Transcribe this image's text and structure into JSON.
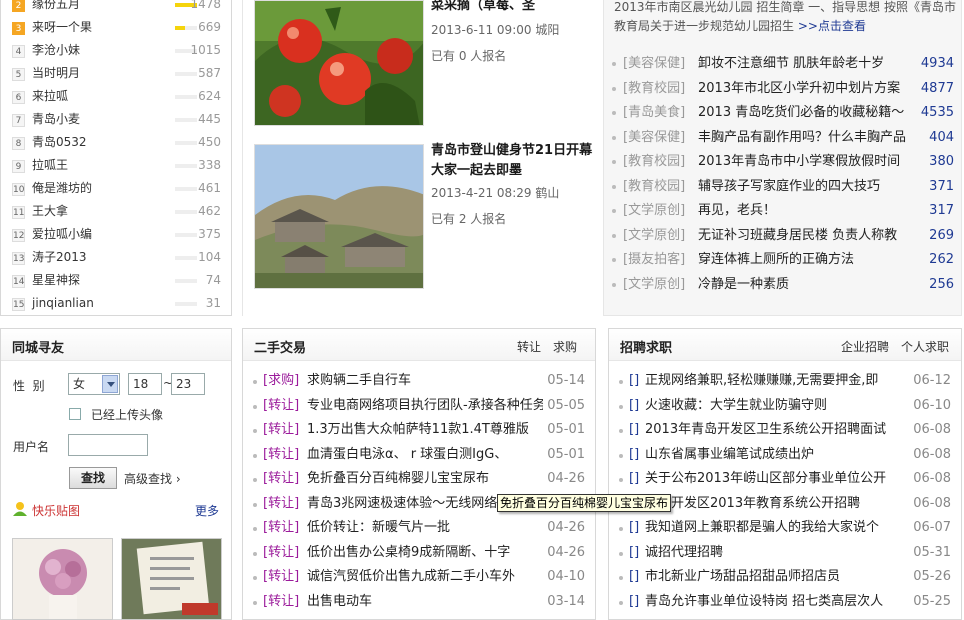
{
  "ranking": {
    "items": [
      {
        "rank": "2",
        "name": "缘份五月",
        "value": "1478",
        "bar": 1.0
      },
      {
        "rank": "3",
        "name": "来呀一个果",
        "value": "669",
        "bar": 0.45
      },
      {
        "rank": "4",
        "name": "李沧小妹",
        "value": "1015",
        "bar": 0.0
      },
      {
        "rank": "5",
        "name": "当时明月",
        "value": "587",
        "bar": 0.0
      },
      {
        "rank": "6",
        "name": "来拉呱",
        "value": "624",
        "bar": 0.0
      },
      {
        "rank": "7",
        "name": "青岛小麦",
        "value": "445",
        "bar": 0.0
      },
      {
        "rank": "8",
        "name": "青岛0532",
        "value": "450",
        "bar": 0.0
      },
      {
        "rank": "9",
        "name": "拉呱王",
        "value": "338",
        "bar": 0.0
      },
      {
        "rank": "10",
        "name": "俺是潍坊的",
        "value": "461",
        "bar": 0.0
      },
      {
        "rank": "11",
        "name": "王大拿",
        "value": "462",
        "bar": 0.0
      },
      {
        "rank": "12",
        "name": "爱拉呱小编",
        "value": "375",
        "bar": 0.0
      },
      {
        "rank": "13",
        "name": "涛子2013",
        "value": "104",
        "bar": 0.0
      },
      {
        "rank": "14",
        "name": "星星神探",
        "value": "74",
        "bar": 0.0
      },
      {
        "rank": "15",
        "name": "jinqianlian",
        "value": "31",
        "bar": 0.0
      }
    ]
  },
  "activities": [
    {
      "title": "菜采摘（草莓、圣",
      "date": "2013-6-11 09:00 城阳",
      "signup": "已有 0 人报名"
    },
    {
      "title": "青岛市登山健身节21日开幕 大家一起去即墨",
      "date": "2013-4-21 08:29 鹤山",
      "signup": "已有 2 人报名"
    }
  ],
  "news": {
    "intro": "2013年市南区晨光幼儿园 招生简章 一、指导思想 按照《青岛市教育局关于进一步规范幼儿园招生",
    "intro_more": ">>点击查看",
    "items": [
      {
        "cat": "[美容保健]",
        "title": "卸妆不注意细节 肌肤年龄老十岁",
        "count": "4934"
      },
      {
        "cat": "[教育校园]",
        "title": "2013年市北区小学升初中划片方案",
        "count": "4877"
      },
      {
        "cat": "[青岛美食]",
        "title": "2013 青岛吃货们必备的收藏秘籍～",
        "count": "4535"
      },
      {
        "cat": "[美容保健]",
        "title": "丰胸产品有副作用吗？什么丰胸产品",
        "count": "404"
      },
      {
        "cat": "[教育校园]",
        "title": "2013年青岛市中小学寒假放假时间",
        "count": "380"
      },
      {
        "cat": "[教育校园]",
        "title": "辅导孩子写家庭作业的四大技巧",
        "count": "371"
      },
      {
        "cat": "[文学原创]",
        "title": "再见，老兵！",
        "count": "317"
      },
      {
        "cat": "[文学原创]",
        "title": "无证补习班藏身居民楼 负责人称教",
        "count": "269"
      },
      {
        "cat": "[摄友拍客]",
        "title": "穿连体裤上厕所的正确方法",
        "count": "262"
      },
      {
        "cat": "[文学原创]",
        "title": "冷静是一种素质",
        "count": "256"
      }
    ]
  },
  "friend": {
    "title": "同城寻友",
    "gender_label": "性  别",
    "gender_value": "女",
    "age_from": "18",
    "age_sep": "~",
    "age_to": "23",
    "avatar_check_label": "已经上传头像",
    "username_label": "用户名",
    "username_value": "",
    "search_button": "查找",
    "advanced_search": "高级查找 ›",
    "stickers_title": "快乐贴图",
    "stickers_more": "更多"
  },
  "trade": {
    "title": "二手交易",
    "link_transfer": "转让",
    "link_buy": "求购",
    "items": [
      {
        "tag": "[求购]",
        "title": "求购辆二手自行车",
        "date": "05-14"
      },
      {
        "tag": "[转让]",
        "title": "专业电商网络项目执行团队-承接各种任务",
        "date": "05-05"
      },
      {
        "tag": "[转让]",
        "title": "1.3万出售大众帕萨特11款1.4T尊雅版",
        "date": "05-01"
      },
      {
        "tag": "[转让]",
        "title": "血清蛋白电泳α、 r 球蛋白测IgG、",
        "date": "05-01"
      },
      {
        "tag": "[转让]",
        "title": "免折叠百分百纯棉婴儿宝宝尿布",
        "date": "04-26"
      },
      {
        "tag": "[转让]",
        "title": "青岛3兆网速极速体验～无线网络",
        "date": "04-26"
      },
      {
        "tag": "[转让]",
        "title": "低价转让：新暖气片一批",
        "date": "04-26"
      },
      {
        "tag": "[转让]",
        "title": "低价出售办公桌椅9成新隔断、十字",
        "date": "04-26"
      },
      {
        "tag": "[转让]",
        "title": "诚信汽贸低价出售九成新二手小车外",
        "date": "04-10"
      },
      {
        "tag": "[转让]",
        "title": "出售电动车",
        "date": "03-14"
      }
    ],
    "tooltip": "免折叠百分百纯棉婴儿宝宝尿布"
  },
  "jobs": {
    "title": "招聘求职",
    "link_company": "企业招聘",
    "link_personal": "个人求职",
    "items": [
      {
        "tag": "[]",
        "title": "正规网络兼职,轻松赚赚赚,无需要押金,即",
        "date": "06-12"
      },
      {
        "tag": "[]",
        "title": "火速收藏：大学生就业防骗守则",
        "date": "06-10"
      },
      {
        "tag": "[]",
        "title": "2013年青岛开发区卫生系统公开招聘面试",
        "date": "06-08"
      },
      {
        "tag": "[]",
        "title": "山东省属事业编笔试成绩出炉",
        "date": "06-08"
      },
      {
        "tag": "[]",
        "title": "关于公布2013年崂山区部分事业单位公开",
        "date": "06-08"
      },
      {
        "tag": "[]",
        "title": "青岛开发区2013年教育系统公开招聘",
        "date": "06-08"
      },
      {
        "tag": "[]",
        "title": "我知道网上兼职都是骗人的我给大家说个",
        "date": "06-07"
      },
      {
        "tag": "[]",
        "title": "诚招代理招聘",
        "date": "05-31"
      },
      {
        "tag": "[]",
        "title": "市北新业广场甜品招甜品师招店员",
        "date": "05-26"
      },
      {
        "tag": "[]",
        "title": "青岛允许事业单位设特岗 招七类高层次人",
        "date": "05-25"
      }
    ]
  },
  "colors": {
    "tag_purple": "#9b1b9b",
    "tag_blue": "#1f3a93",
    "count_blue": "#1f3a93",
    "bar_yellow": "#f5d40c"
  }
}
